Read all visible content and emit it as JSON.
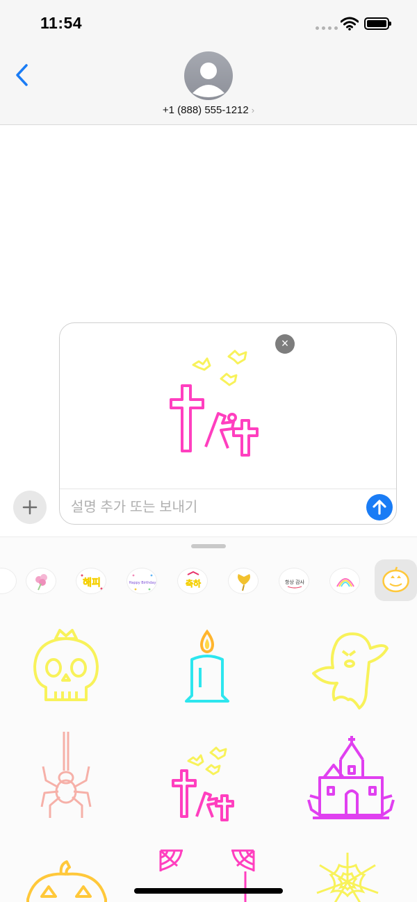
{
  "status_bar": {
    "time": "11:54",
    "icons": [
      "signal-dots-icon",
      "wifi-icon",
      "battery-icon"
    ]
  },
  "header": {
    "back_icon": "chevron-left-icon",
    "avatar_icon": "person-silhouette-icon",
    "contact": "+1 (888) 555-1212",
    "contact_chevron": "›"
  },
  "compose": {
    "remove_label": "×",
    "placeholder": "설명 추가 또는 보내기",
    "attached_sticker": "halloween-graves-bats-sticker",
    "send_icon": "arrow-up-icon",
    "plus_icon": "plus-icon"
  },
  "drawer": {
    "pack_icons": [
      "partial-pack-icon",
      "flower-bouquet-icon",
      "happy-korean-text-icon",
      "happy-birthday-icon",
      "congrats-korean-icon",
      "ginkgo-leaf-icon",
      "thanks-korean-icon",
      "neon-rainbow-icon",
      "pumpkin-pack-icon"
    ],
    "pack_labels": {
      "happy": "해피",
      "birthday": "Happy Birthday",
      "congrats": "축하",
      "thanks": "항상 감사"
    },
    "stickers": [
      "crowned-skull-sticker",
      "candle-sticker",
      "ghost-sticker",
      "spider-sticker",
      "graves-bats-sticker",
      "haunted-castle-sticker",
      "jack-o-lantern-sticker",
      "spiderwebs-sticker",
      "cobweb-sticker"
    ]
  },
  "colors": {
    "accent_blue": "#1a7cf5",
    "neon_pink": "#ff3fbf",
    "neon_yellow": "#f8f25a",
    "neon_cyan": "#2de6ee",
    "neon_magenta": "#e040f0",
    "neon_peach": "#f6b0a8",
    "neon_orange": "#ffc83a"
  }
}
